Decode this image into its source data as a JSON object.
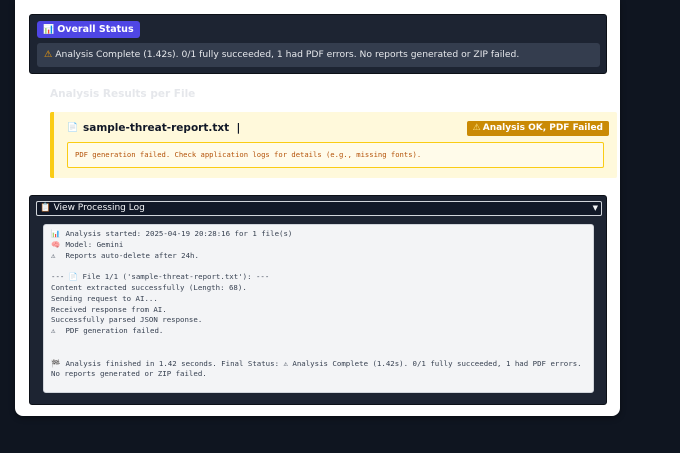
{
  "overall": {
    "title": "Overall Status",
    "message": "Analysis Complete (1.42s). 0/1 fully succeeded, 1 had PDF errors. No reports generated or ZIP failed."
  },
  "results": {
    "heading": "Analysis Results per File",
    "file_name": "sample-threat-report.txt",
    "cursor": "|",
    "badge": "Analysis OK, PDF Failed",
    "message": "PDF generation failed. Check application logs for details (e.g., missing fonts)."
  },
  "log": {
    "toggle_label": "View Processing Log",
    "lines": [
      {
        "icon": "📊",
        "text": "Analysis started: 2025-04-19 20:28:16 for 1 file(s)"
      },
      {
        "icon": "🧠",
        "text": "Model: Gemini"
      },
      {
        "icon": "⚠",
        "text": "Reports auto-delete after 24h."
      },
      {
        "icon": "",
        "text": ""
      },
      {
        "icon": "",
        "text": "--- 📄 File 1/1 ('sample-threat-report.txt'): ---"
      },
      {
        "icon": "",
        "text": "Content extracted successfully (Length: 68)."
      },
      {
        "icon": "",
        "text": "Sending request to AI..."
      },
      {
        "icon": "",
        "text": "Received response from AI."
      },
      {
        "icon": "",
        "text": "Successfully parsed JSON response."
      },
      {
        "icon": "⚠",
        "text": "PDF generation failed."
      },
      {
        "icon": "",
        "text": ""
      },
      {
        "icon": "",
        "text": ""
      }
    ],
    "final_icon": "🏁",
    "final_text": "Analysis finished in 1.42 seconds. Final Status: ⚠ Analysis Complete (1.42s). 0/1 fully succeeded, 1 had PDF errors. No reports generated or ZIP failed."
  },
  "icons": {
    "status": "chart-icon",
    "warning": "warning-icon",
    "file": "file-icon",
    "log": "clipboard-icon"
  },
  "colors": {
    "status_chip": "#4f46e5",
    "badge": "#ca8a04",
    "result_border": "#facc15"
  }
}
